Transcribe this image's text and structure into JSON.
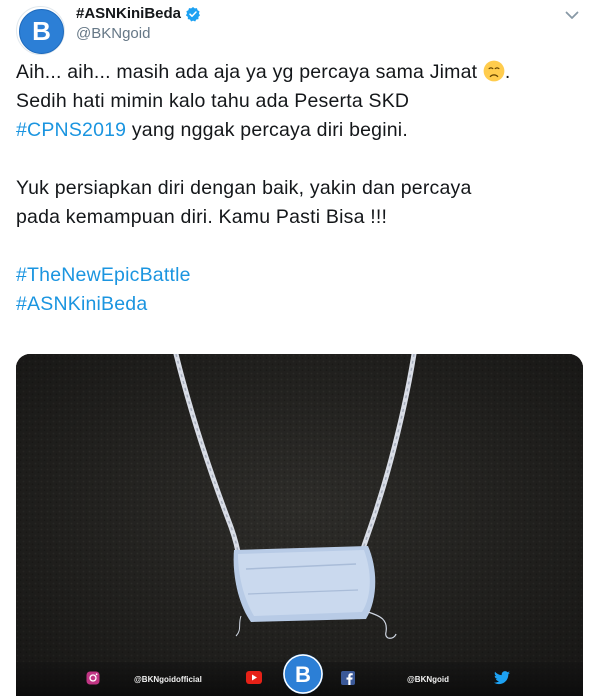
{
  "author": {
    "display_name": "#ASNKiniBeda",
    "handle": "@BKNgoid",
    "verified": true,
    "avatar_letter": "B"
  },
  "tweet": {
    "line1_pre": "Aih... aih... masih ada aja ya yg percaya sama Jimat ",
    "line1_post": ".",
    "line2": "Sedih hati mimin kalo tahu ada Peserta SKD",
    "line3_hashtag": "#CPNS2019",
    "line3_rest": " yang nggak percaya diri begini.",
    "line4": "Yuk persiapkan diri dengan baik, yakin dan percaya",
    "line5": "pada kemampuan diri. Kamu Pasti Bisa !!!",
    "hashtag1": "#TheNewEpicBattle",
    "hashtag2": "#ASNKiniBeda",
    "emoji": "disappointed-face-emoji"
  },
  "media": {
    "footer_instagram": "@BKNgoidofficial",
    "footer_twitter": "@BKNgoid",
    "center_logo_letter": "B"
  },
  "colors": {
    "hashtag": "#1b95e0",
    "brand_blue": "#2c7fd6",
    "text": "#14171a",
    "muted": "#657786"
  }
}
